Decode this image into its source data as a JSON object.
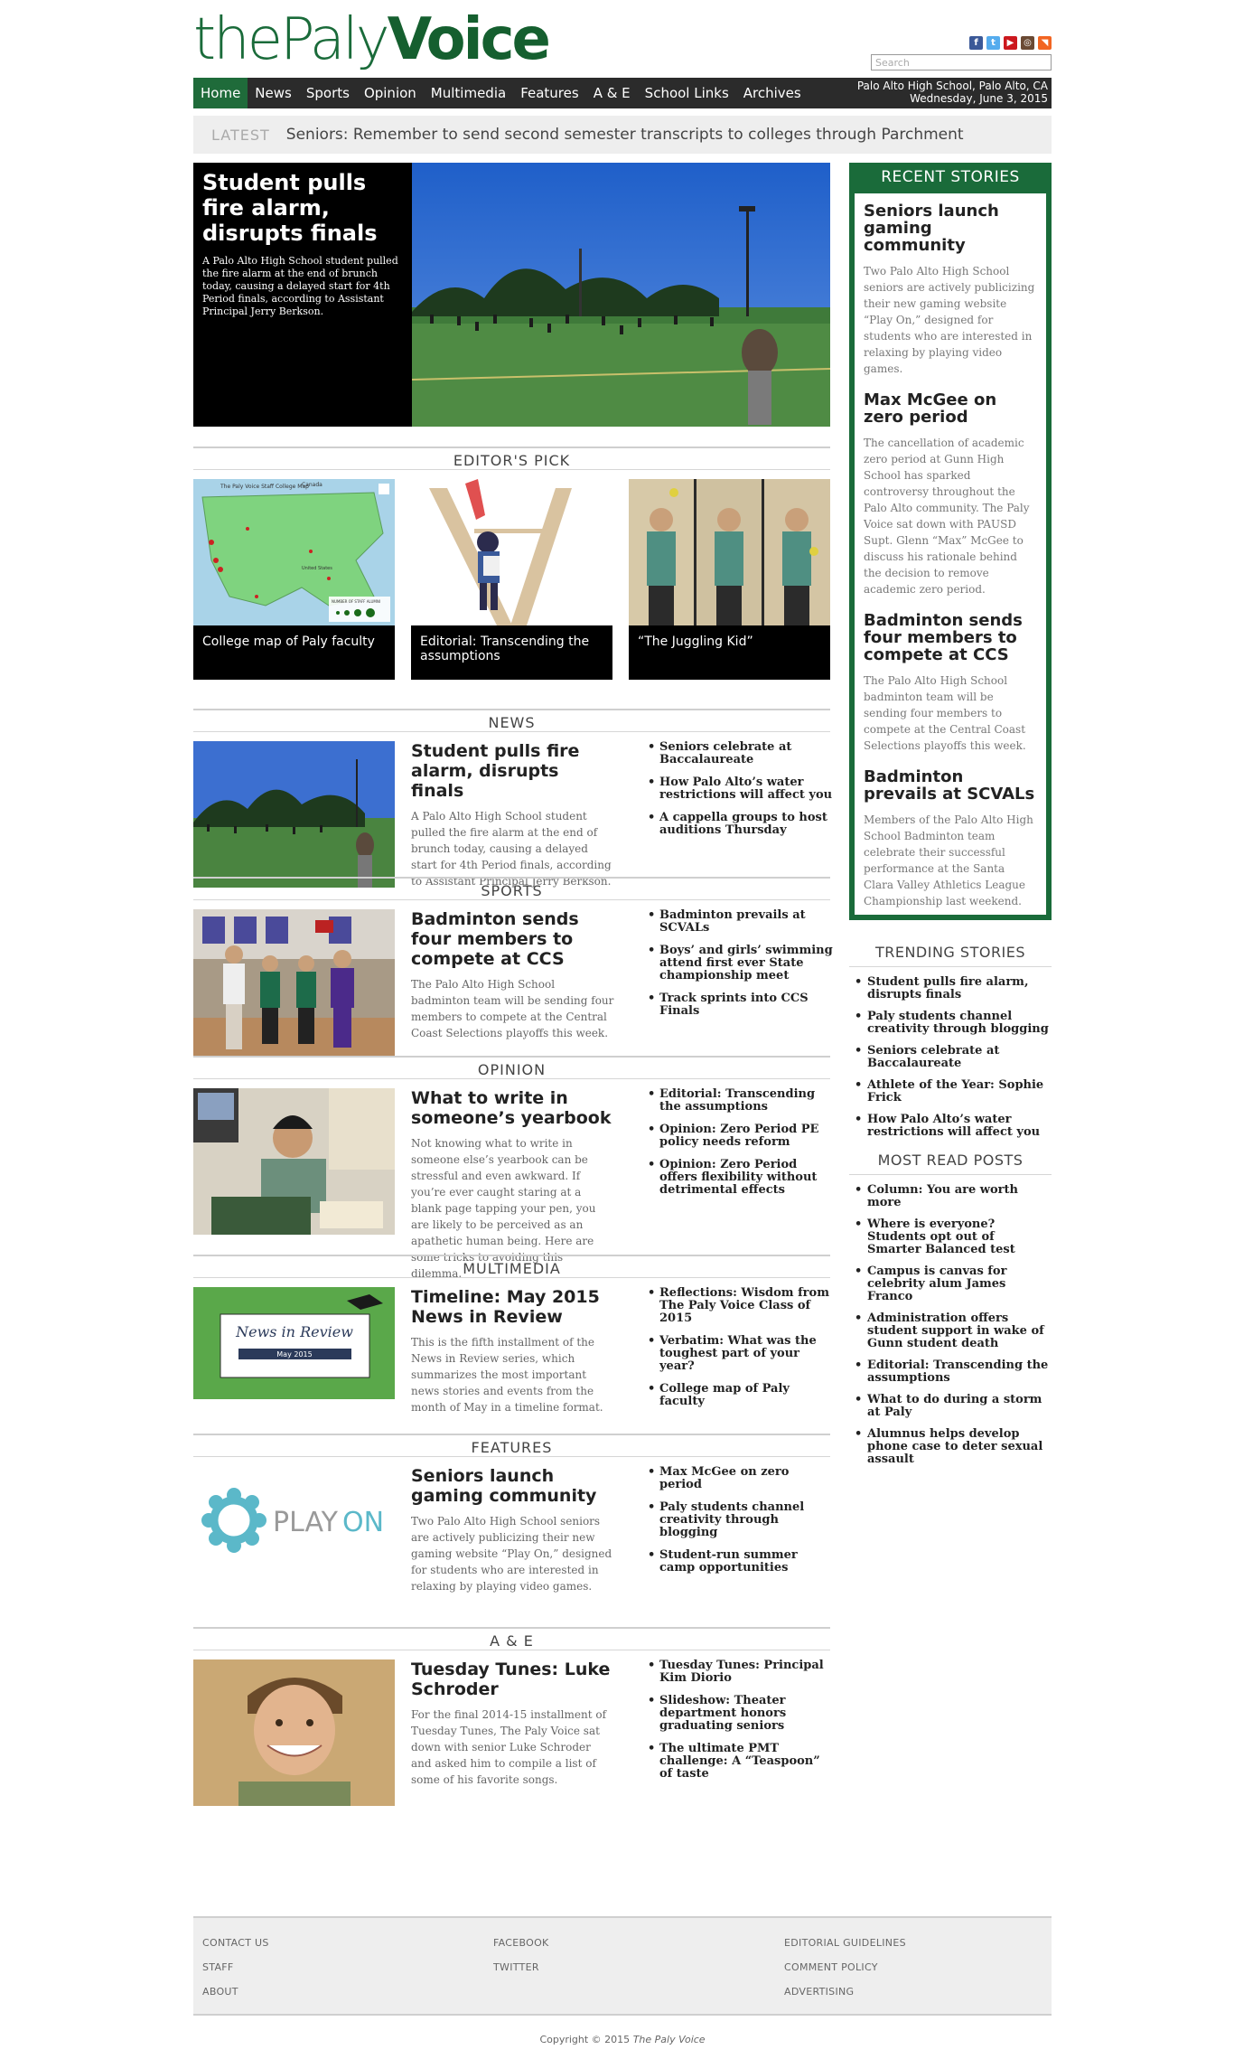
{
  "masthead": {
    "logo_thin": "thePaly",
    "logo_bold": "Voice",
    "search_placeholder": "Search"
  },
  "social": [
    {
      "name": "facebook-icon",
      "glyph": "f",
      "color": "#3b5998"
    },
    {
      "name": "twitter-icon",
      "glyph": "t",
      "color": "#55acee"
    },
    {
      "name": "youtube-icon",
      "glyph": "▶",
      "color": "#cc181e"
    },
    {
      "name": "instagram-icon",
      "glyph": "◎",
      "color": "#6b4a34"
    },
    {
      "name": "rss-icon",
      "glyph": "◥",
      "color": "#f26522"
    }
  ],
  "nav": {
    "items": [
      "Home",
      "News",
      "Sports",
      "Opinion",
      "Multimedia",
      "Features",
      "A & E",
      "School Links",
      "Archives"
    ],
    "location": "Palo Alto High School, Palo Alto, CA",
    "date": "Wednesday, June 3, 2015"
  },
  "latest": {
    "label": "LATEST",
    "text": "Seniors: Remember to send second semester transcripts to colleges through Parchment"
  },
  "hero": {
    "title": "Student pulls fire alarm, disrupts finals",
    "summary": "A Palo Alto High School student pulled the fire alarm at the end of brunch today, causing a delayed start for 4th Period finals, according to Assistant Principal Jerry Berkson."
  },
  "editors_pick": {
    "heading": "EDITOR'S PICK",
    "items": [
      {
        "caption": "College map of Paly faculty",
        "map_title": "The Paly Voice Staff College Map",
        "map_label": "Canada",
        "map_label2": "United States",
        "map_legend": "NUMBER OF STAFF ALUMNI"
      },
      {
        "caption": "Editorial: Transcending the assumptions"
      },
      {
        "caption": "“The Juggling Kid”"
      }
    ]
  },
  "sections": [
    {
      "heading": "NEWS",
      "title": "Student pulls fire alarm, disrupts finals",
      "summary": "A Palo Alto High School student pulled the fire alarm at the end of brunch today, causing a delayed start for 4th Period finals, according to Assistant Principal Jerry Berkson.",
      "links": [
        "Seniors celebrate at Baccalaureate",
        "How Palo Alto’s water restrictions will affect you",
        "A cappella groups to host auditions Thursday"
      ]
    },
    {
      "heading": "SPORTS",
      "title": "Badminton sends four members to compete at CCS",
      "summary": "The Palo Alto High School badminton team will be sending four members to compete at the Central Coast Selections playoffs this week.",
      "links": [
        "Badminton prevails at SCVALs",
        "Boys’ and girls’ swimming attend first ever State championship meet",
        "Track sprints into CCS Finals"
      ]
    },
    {
      "heading": "OPINION",
      "title": "What to write in someone’s yearbook",
      "summary": "Not knowing what to write in someone else’s yearbook can be stressful and even awkward. If you’re ever caught staring at a blank page tapping your pen, you are likely to be perceived as an apathetic human being. Here are some tricks to avoiding this dilemma.",
      "links": [
        "Editorial: Transcending the assumptions",
        "Opinion: Zero Period PE policy needs reform",
        "Opinion: Zero Period offers flexibility without detrimental effects"
      ]
    },
    {
      "heading": "MULTIMEDIA",
      "title": "Timeline: May 2015 News in Review",
      "summary": "This is the fifth installment of the News in Review series, which summarizes the most important news stories and events from the month of May in a timeline format.",
      "links": [
        "Reflections: Wisdom from The Paly Voice Class of 2015",
        "Verbatim: What was the toughest part of your year?",
        "College map of Paly faculty"
      ],
      "badge_title": "News in Review",
      "badge_sub": "May 2015"
    },
    {
      "heading": "FEATURES",
      "title": "Seniors launch gaming community",
      "summary": "Two Palo Alto High School seniors are actively publicizing their new gaming website “Play On,” designed for students who are interested in relaxing by playing video games.",
      "links": [
        "Max McGee on zero period",
        "Paly students channel creativity through blogging",
        "Student-run summer camp opportunities"
      ],
      "logo_a": "PLAY",
      "logo_b": "ON"
    },
    {
      "heading": "A & E",
      "title": "Tuesday Tunes: Luke Schroder",
      "summary": "For the final 2014-15 installment of Tuesday Tunes, The Paly Voice sat down with senior Luke Schroder and asked him to compile a list of some of his favorite songs.",
      "links": [
        "Tuesday Tunes: Principal Kim Diorio",
        "Slideshow: Theater department honors graduating seniors",
        "The ultimate PMT challenge: A “Teaspoon” of taste"
      ]
    }
  ],
  "recent": {
    "heading": "RECENT STORIES",
    "items": [
      {
        "title": "Seniors launch gaming community",
        "summary": "Two Palo Alto High School seniors are actively publicizing their new gaming website “Play On,” designed for students who are interested in relaxing by playing video games."
      },
      {
        "title": "Max McGee on zero period",
        "summary": "The cancellation of academic zero period at Gunn High School has sparked controversy throughout the Palo Alto community. The Paly Voice sat down with PAUSD Supt. Glenn “Max” McGee to discuss his rationale behind the decision to remove academic zero period."
      },
      {
        "title": "Badminton sends four members to compete at CCS",
        "summary": "The Palo Alto High School badminton team will be sending four members to compete at the Central Coast Selections playoffs this week."
      },
      {
        "title": "Badminton prevails at SCVALs",
        "summary": "Members of the Palo Alto High School Badminton team celebrate their successful performance at the Santa Clara Valley Athletics League Championship last weekend."
      }
    ]
  },
  "trending": {
    "heading": "TRENDING STORIES",
    "items": [
      "Student pulls fire alarm, disrupts finals",
      "Paly students channel creativity through blogging",
      "Seniors celebrate at Baccalaureate",
      "Athlete of the Year: Sophie Frick",
      "How Palo Alto’s water restrictions will affect you"
    ]
  },
  "most_read": {
    "heading": "MOST READ POSTS",
    "items": [
      "Column: You are worth more",
      "Where is everyone? Students opt out of Smarter Balanced test",
      "Campus is canvas for celebrity alum James Franco",
      "Administration offers student support in wake of Gunn student death",
      "Editorial: Transcending the assumptions",
      "What to do during a storm at Paly",
      "Alumnus helps develop phone case to deter sexual assault"
    ]
  },
  "footer": {
    "col1": [
      "CONTACT US",
      "STAFF",
      "ABOUT"
    ],
    "col2": [
      "FACEBOOK",
      "TWITTER"
    ],
    "col3": [
      "EDITORIAL GUIDELINES",
      "COMMENT POLICY",
      "ADVERTISING"
    ],
    "copyright": "Copyright © 2015",
    "copyright_name": "The Paly Voice"
  },
  "colors": {
    "brand_green": "#1a6b3a",
    "nav_dark": "#2b2b2b"
  }
}
